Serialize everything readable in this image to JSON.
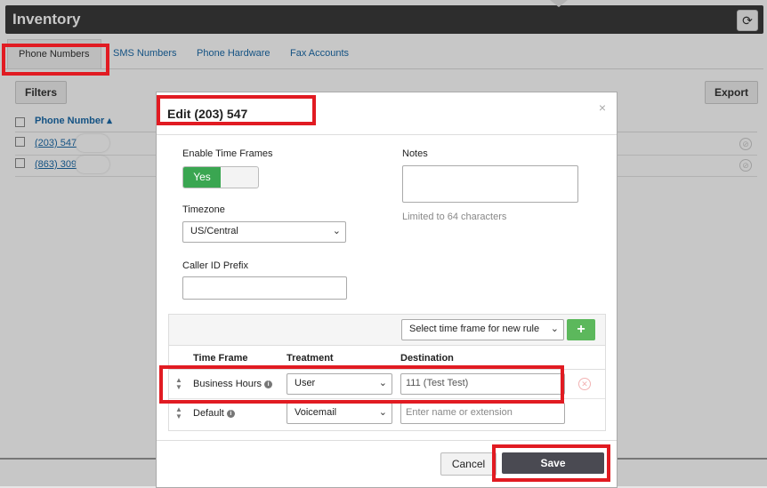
{
  "app": {
    "title": "Inventory"
  },
  "tabs": [
    "Phone Numbers",
    "SMS Numbers",
    "Phone Hardware",
    "Fax Accounts"
  ],
  "toolbar": {
    "filters_label": "Filters",
    "export_label": "Export"
  },
  "list": {
    "header": "Phone Number ▴",
    "rows": [
      {
        "number": "(203) 547"
      },
      {
        "number": "(863) 309"
      }
    ]
  },
  "modal": {
    "title": "Edit (203) 547",
    "close": "×",
    "enable_label": "Enable Time Frames",
    "toggle_on": "Yes",
    "timezone_label": "Timezone",
    "timezone_value": "US/Central",
    "callerid_label": "Caller ID Prefix",
    "callerid_value": "",
    "notes_label": "Notes",
    "notes_hint": "Limited to 64 characters",
    "new_rule_select": "Select time frame for new rule",
    "add_button": "+",
    "columns": {
      "time_frame": "Time Frame",
      "treatment": "Treatment",
      "destination": "Destination"
    },
    "rules": [
      {
        "time_frame": "Business Hours",
        "treatment": "User",
        "destination": "111 (Test Test)",
        "destination_placeholder": ""
      },
      {
        "time_frame": "Default",
        "treatment": "Voicemail",
        "destination": "",
        "destination_placeholder": "Enter name or extension"
      }
    ],
    "cancel_label": "Cancel",
    "save_label": "Save"
  },
  "colors": {
    "accent_link": "#1a6aa8",
    "toggle_on": "#3aa651",
    "add_button": "#5cb85c",
    "save_button": "#4a4a52",
    "highlight": "#e11b22"
  }
}
